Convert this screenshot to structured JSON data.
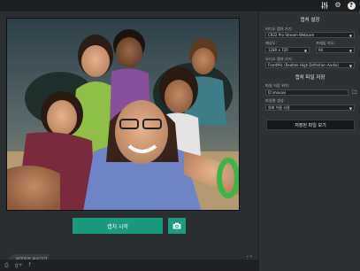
{
  "top_icons": [
    {
      "icon": "sliders-icon"
    },
    {
      "icon": "gear-icon"
    },
    {
      "icon": "help-icon"
    }
  ],
  "preview": {
    "description_icon": "webcam-preview-image"
  },
  "buttons": {
    "capture_label": "캡처 시작",
    "back_label": "환영화면 돌아가기"
  },
  "social_icons": [
    "printer-icon",
    "google-plus-icon",
    "facebook-icon"
  ],
  "settings": {
    "video_section_title": "캡처 설정",
    "video_device_label": "비디오 캡처 기기:",
    "video_device_value": "C922 Pro Stream Webcam",
    "resolution_label": "해상도:",
    "resolution_value": "1280 x 720",
    "framerate_label": "프레임 속도:",
    "framerate_value": "60",
    "audio_device_label": "오디오 캡처 기기:",
    "audio_device_value": "FrontMic (Realtek High Definition Audio)",
    "save_section_title": "캡처 파일 저장",
    "save_path_label": "파일 저장 위치:",
    "save_path_value": "D:\\movavi",
    "filename_label": "파일명 생성:",
    "filename_value": "원래 이름 사용",
    "view_files_label": "저장된 파일 보기"
  }
}
